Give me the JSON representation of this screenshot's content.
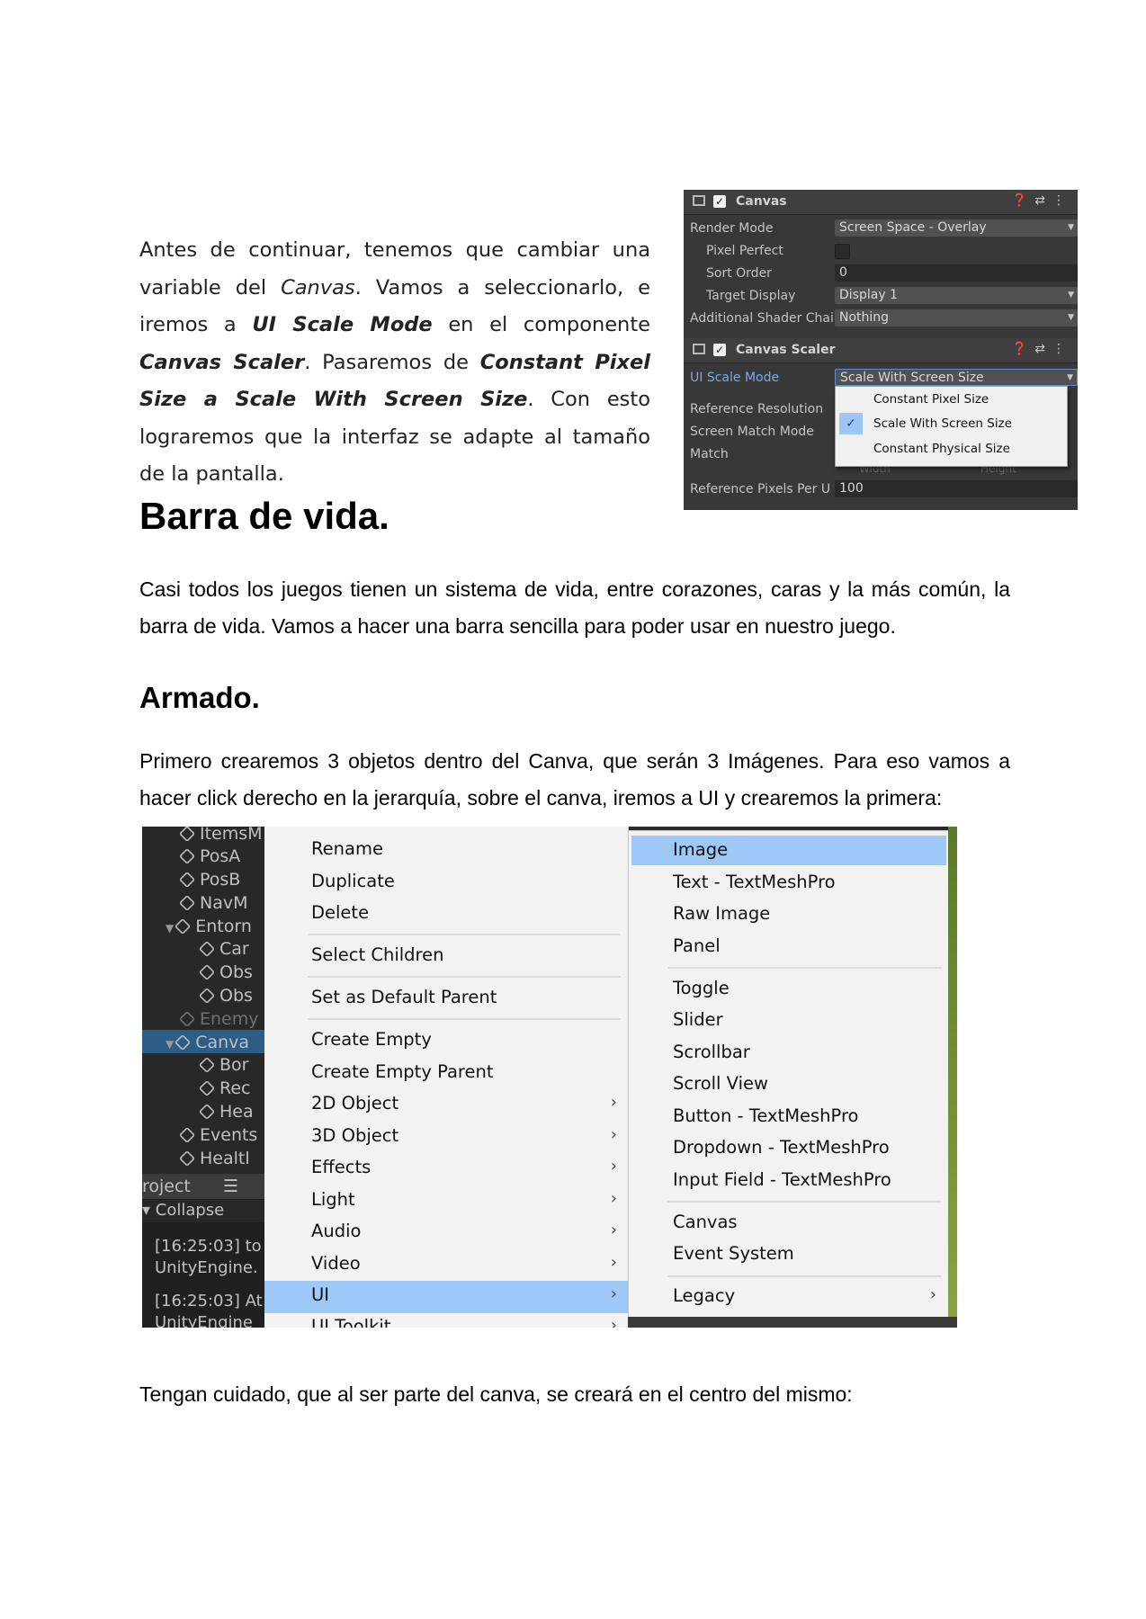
{
  "intro": {
    "t1": "Antes de continuar, tenemos que cambiar una variable del ",
    "canvas": "Canvas",
    "t2": ". Vamos a seleccionarlo, e iremos a ",
    "ui_scale_mode": "UI Scale Mode",
    "t3": " en el componente ",
    "canvas_scaler": "Canvas Scaler",
    "t4": ". Pasaremos de ",
    "constant_pixel_size": "Constant Pixel Size",
    "t5": " a ",
    "scale_with_screen_size": "Scale With Screen Size",
    "t6": ". Con esto lograremos que la interfaz se adapte al tamaño de la pantalla."
  },
  "inspector": {
    "canvas_header": "Canvas",
    "render_mode_label": "Render Mode",
    "render_mode_value": "Screen Space - Overlay",
    "pixel_perfect_label": "Pixel Perfect",
    "sort_order_label": "Sort Order",
    "sort_order_value": "0",
    "target_display_label": "Target Display",
    "target_display_value": "Display 1",
    "shader_label": "Additional Shader Chai",
    "shader_value": "Nothing",
    "scaler_header": "Canvas Scaler",
    "ui_scale_mode_label": "UI Scale Mode",
    "ui_scale_mode_value": "Scale With Screen Size",
    "ref_res_label": "Reference Resolution",
    "screen_match_label": "Screen Match Mode",
    "match_label": "Match",
    "ref_pixels_label": "Reference Pixels Per U",
    "ref_pixels_value": "100",
    "ghost_width": "Width",
    "ghost_height": "Height",
    "dropdown": [
      "Constant Pixel Size",
      "Scale With Screen Size",
      "Constant Physical Size"
    ],
    "header_icons": "❓⇄⋮"
  },
  "h1": "Barra de vida.",
  "p1": "Casi todos los juegos tienen un sistema de vida, entre corazones, caras y la más común, la barra de vida. Vamos a hacer una barra sencilla para poder usar en nuestro juego.",
  "h2": "Armado.",
  "p2": "Primero crearemos 3 objetos dentro del Canva, que serán 3 Imágenes. Para eso vamos a hacer click derecho en la jerarquía, sobre el canva, iremos a UI y crearemos la primera:",
  "hierarchy": {
    "items": [
      "ItemsM",
      "PosA",
      "PosB",
      "NavM",
      "Entorn",
      "Car",
      "Obs",
      "Obs",
      "Enemy",
      "Canva",
      "Bor",
      "Rec",
      "Hea",
      "Events",
      "Healtl"
    ],
    "project_tab": "roject",
    "collapse": "Collapse",
    "console_lines": [
      "[16:25:03] to",
      "UnityEngine.",
      "[16:25:03] At",
      "UnityEngine"
    ]
  },
  "context_menu": {
    "items": [
      "Rename",
      "Duplicate",
      "Delete",
      "Select Children",
      "Set as Default Parent",
      "Create Empty",
      "Create Empty Parent",
      "2D Object",
      "3D Object",
      "Effects",
      "Light",
      "Audio",
      "Video",
      "UI",
      "UI Toolkit"
    ],
    "submenu_arrow": "›"
  },
  "ui_submenu": {
    "items": [
      "Image",
      "Text - TextMeshPro",
      "Raw Image",
      "Panel",
      "Toggle",
      "Slider",
      "Scrollbar",
      "Scroll View",
      "Button - TextMeshPro",
      "Dropdown - TextMeshPro",
      "Input Field - TextMeshPro",
      "Canvas",
      "Event System",
      "Legacy"
    ]
  },
  "p3": "Tengan cuidado, que al ser parte del canva, se creará en el centro del mismo:",
  "colors": {
    "unity_dark": "#383838",
    "highlight_blue": "#9dc8f7",
    "selection_blue": "#2c5d87"
  }
}
